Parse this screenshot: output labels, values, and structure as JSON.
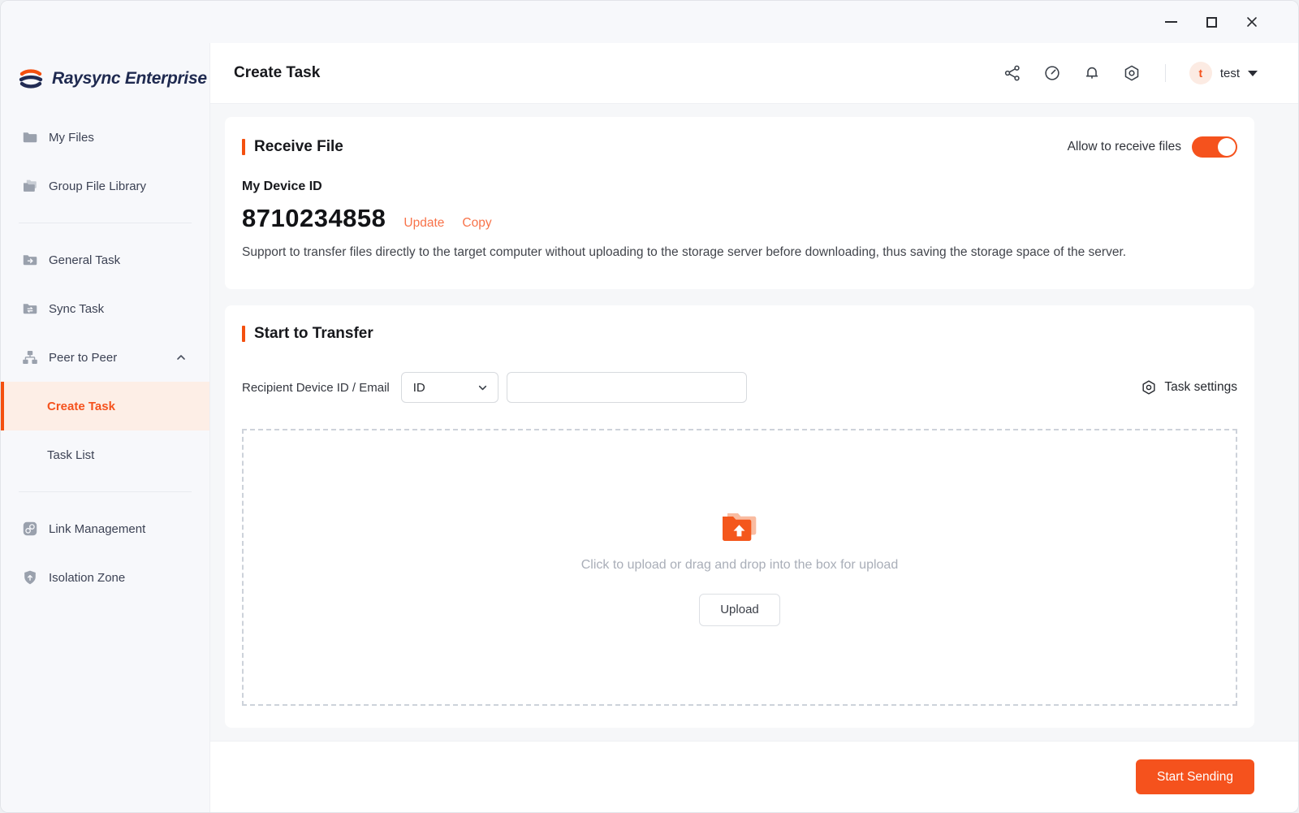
{
  "window": {
    "controls": {
      "minimize": "minimize-icon",
      "maximize": "maximize-icon",
      "close": "close-icon"
    }
  },
  "brand": {
    "name": "Raysync Enterprise"
  },
  "sidebar": {
    "items": [
      {
        "label": "My Files",
        "icon": "folder-icon"
      },
      {
        "label": "Group File Library",
        "icon": "folders-icon"
      },
      {
        "label": "General Task",
        "icon": "folder-arrow-icon"
      },
      {
        "label": "Sync Task",
        "icon": "folder-sync-icon"
      },
      {
        "label": "Peer to Peer",
        "icon": "network-icon",
        "expanded": true
      },
      {
        "label": "Create Task",
        "parent": "Peer to Peer",
        "active": true
      },
      {
        "label": "Task List",
        "parent": "Peer to Peer"
      },
      {
        "label": "Link Management",
        "icon": "link-icon"
      },
      {
        "label": "Isolation Zone",
        "icon": "shield-icon"
      }
    ]
  },
  "header": {
    "title": "Create Task",
    "icons": [
      "share-icon",
      "speed-gauge-icon",
      "notification-bell-icon",
      "settings-gear-icon"
    ],
    "user": {
      "initial": "t",
      "name": "test"
    }
  },
  "receive": {
    "title": "Receive File",
    "toggle_label": "Allow to receive files",
    "toggle_state": "on",
    "device_id_label": "My Device ID",
    "device_id": "8710234858",
    "update_label": "Update",
    "copy_label": "Copy",
    "description": "Support to transfer files directly to the target computer without uploading to the storage server before downloading, thus saving the storage space of the server."
  },
  "transfer": {
    "title": "Start to Transfer",
    "recipient_label": "Recipient Device ID / Email",
    "recipient_type": "ID",
    "recipient_value": "",
    "task_settings_label": "Task settings",
    "upload_hint": "Click to upload or drag and drop into the box for upload",
    "upload_button": "Upload",
    "start_button": "Start Sending"
  },
  "colors": {
    "accent": "#f5521d",
    "accent_bar": "#f4500f",
    "link": "#f8734a",
    "active_item_bg": "#fdeee6",
    "avatar_bg": "#fcebe3",
    "sidebar_bg": "#f7f8fb",
    "content_bg": "#f6f7f9",
    "icon_gray": "#9aa1ad"
  }
}
